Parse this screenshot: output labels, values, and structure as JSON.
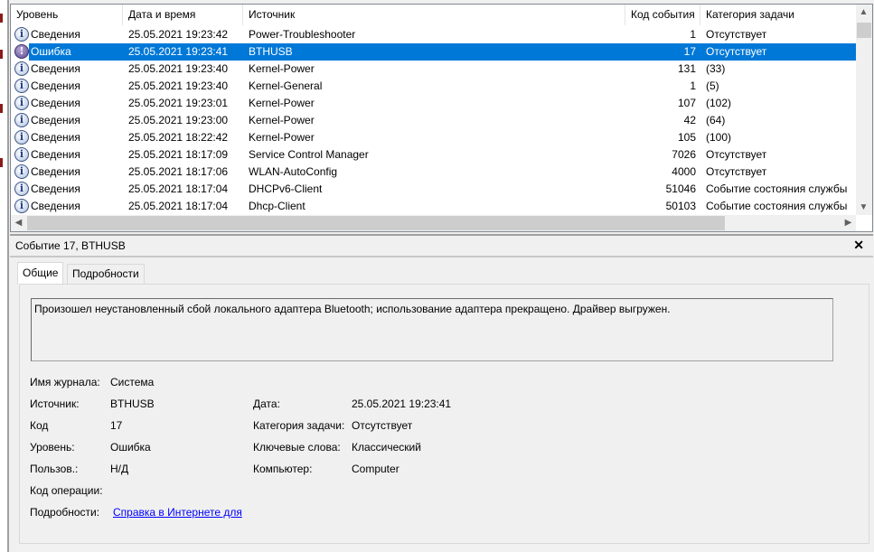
{
  "columns": {
    "level": "Уровень",
    "datetime": "Дата и время",
    "source": "Источник",
    "event_id": "Код события",
    "category": "Категория задачи"
  },
  "rows": [
    {
      "icon": "info-icon",
      "level": "Сведения",
      "datetime": "25.05.2021 19:23:42",
      "source": "Power-Troubleshooter",
      "event_id": "1",
      "category": "Отсутствует"
    },
    {
      "icon": "error-icon",
      "level": "Ошибка",
      "datetime": "25.05.2021 19:23:41",
      "source": "BTHUSB",
      "event_id": "17",
      "category": "Отсутствует",
      "selected": true
    },
    {
      "icon": "info-icon",
      "level": "Сведения",
      "datetime": "25.05.2021 19:23:40",
      "source": "Kernel-Power",
      "event_id": "131",
      "category": "(33)"
    },
    {
      "icon": "info-icon",
      "level": "Сведения",
      "datetime": "25.05.2021 19:23:40",
      "source": "Kernel-General",
      "event_id": "1",
      "category": "(5)"
    },
    {
      "icon": "info-icon",
      "level": "Сведения",
      "datetime": "25.05.2021 19:23:01",
      "source": "Kernel-Power",
      "event_id": "107",
      "category": "(102)"
    },
    {
      "icon": "info-icon",
      "level": "Сведения",
      "datetime": "25.05.2021 19:23:00",
      "source": "Kernel-Power",
      "event_id": "42",
      "category": "(64)"
    },
    {
      "icon": "info-icon",
      "level": "Сведения",
      "datetime": "25.05.2021 18:22:42",
      "source": "Kernel-Power",
      "event_id": "105",
      "category": "(100)"
    },
    {
      "icon": "info-icon",
      "level": "Сведения",
      "datetime": "25.05.2021 18:17:09",
      "source": "Service Control Manager",
      "event_id": "7026",
      "category": "Отсутствует"
    },
    {
      "icon": "info-icon",
      "level": "Сведения",
      "datetime": "25.05.2021 18:17:06",
      "source": "WLAN-AutoConfig",
      "event_id": "4000",
      "category": "Отсутствует"
    },
    {
      "icon": "info-icon",
      "level": "Сведения",
      "datetime": "25.05.2021 18:17:04",
      "source": "DHCPv6-Client",
      "event_id": "51046",
      "category": "Событие состояния службы"
    },
    {
      "icon": "info-icon",
      "level": "Сведения",
      "datetime": "25.05.2021 18:17:04",
      "source": "Dhcp-Client",
      "event_id": "50103",
      "category": "Событие состояния службы"
    }
  ],
  "detail": {
    "title": "Событие 17, BTHUSB",
    "tabs": [
      "Общие",
      "Подробности"
    ],
    "message": "Произошел неустановленный сбой локального адаптера Bluetooth; использование адаптера прекращено. Драйвер выгружен.",
    "fields": {
      "log_label": "Имя журнала:",
      "log": "Система",
      "source_label": "Источник:",
      "source": "BTHUSB",
      "date_label": "Дата:",
      "date": "25.05.2021 19:23:41",
      "code_label": "Код",
      "code": "17",
      "category_label": "Категория задачи:",
      "category": "Отсутствует",
      "level_label": "Уровень:",
      "level": "Ошибка",
      "keywords_label": "Ключевые слова:",
      "keywords": "Классический",
      "user_label": "Пользов.:",
      "user": "Н/Д",
      "computer_label": "Компьютер:",
      "computer": "Computer",
      "opcode_label": "Код операции:",
      "details_label": "Подробности:",
      "details_link": "Справка в Интернете для "
    }
  },
  "colors": {
    "selection": "#0078d7",
    "link": "#0000ff"
  }
}
